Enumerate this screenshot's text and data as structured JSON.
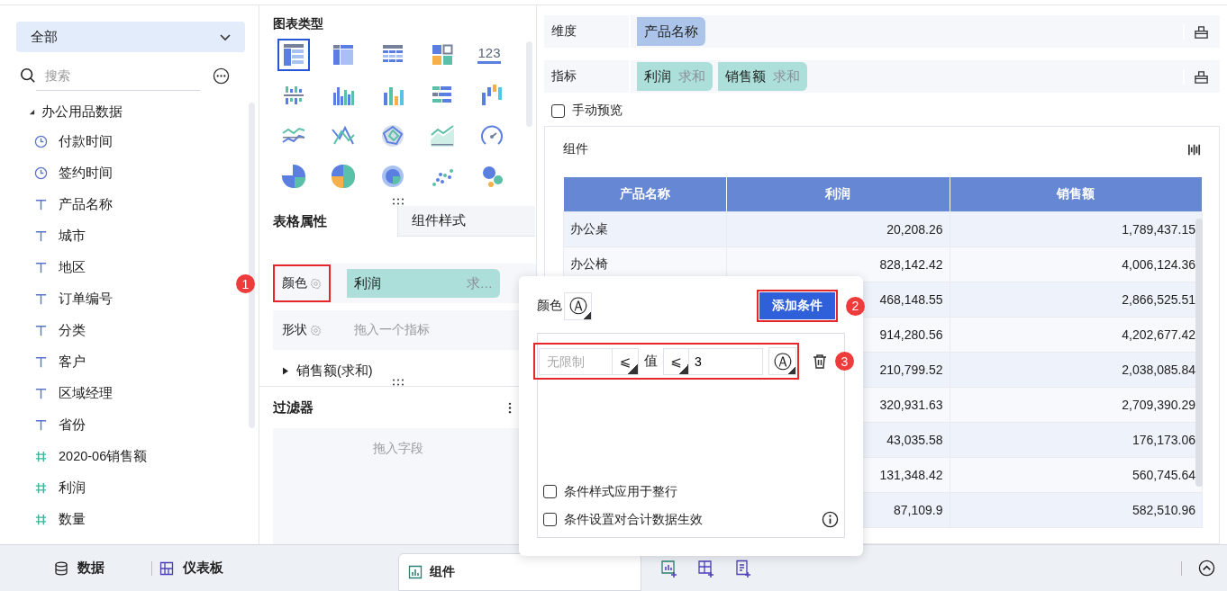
{
  "field_panel": {
    "scope": "全部",
    "search_placeholder": "搜索",
    "tree": [
      {
        "label": "办公用品数据",
        "expanded": true,
        "children": [
          {
            "label": "付款时间",
            "kind": "date"
          },
          {
            "label": "签约时间",
            "kind": "date"
          },
          {
            "label": "产品名称",
            "kind": "text"
          },
          {
            "label": "城市",
            "kind": "text"
          },
          {
            "label": "地区",
            "kind": "text"
          },
          {
            "label": "订单编号",
            "kind": "text"
          },
          {
            "label": "分类",
            "kind": "text"
          },
          {
            "label": "客户",
            "kind": "text"
          },
          {
            "label": "区域经理",
            "kind": "text"
          },
          {
            "label": "省份",
            "kind": "text"
          },
          {
            "label": "2020-06销售额",
            "kind": "number"
          },
          {
            "label": "利润",
            "kind": "number"
          },
          {
            "label": "数量",
            "kind": "number"
          }
        ]
      }
    ]
  },
  "chart_panel": {
    "title": "图表类型",
    "chart_types": [
      {
        "kind": "table",
        "selected": true
      },
      {
        "kind": "cross_table",
        "selected": false
      },
      {
        "kind": "detail_table",
        "selected": false
      },
      {
        "kind": "blocks",
        "selected": false
      },
      {
        "kind": "kpi",
        "label": "123",
        "selected": false
      },
      {
        "kind": "bar_split",
        "selected": false
      },
      {
        "kind": "bar_grouped",
        "selected": false
      },
      {
        "kind": "bar_colored",
        "selected": false
      },
      {
        "kind": "bar_horizontal",
        "selected": false
      },
      {
        "kind": "waterfall",
        "selected": false
      },
      {
        "kind": "line_multi",
        "selected": false
      },
      {
        "kind": "line_cross",
        "selected": false
      },
      {
        "kind": "radar",
        "selected": false
      },
      {
        "kind": "area",
        "selected": false
      },
      {
        "kind": "gauge",
        "selected": false
      },
      {
        "kind": "pie",
        "selected": false
      },
      {
        "kind": "pie_multi",
        "selected": false
      },
      {
        "kind": "ring",
        "selected": false
      },
      {
        "kind": "scatter",
        "selected": false
      },
      {
        "kind": "bubble",
        "selected": false
      }
    ]
  },
  "property_tabs": [
    {
      "label": "表格属性",
      "selected": true
    },
    {
      "label": "组件样式",
      "selected": false
    }
  ],
  "properties": [
    {
      "label": "颜色",
      "field": "利润",
      "aggregate": "求…",
      "callout": "1"
    },
    {
      "label": "形状",
      "placeholder": "拖入一个指标"
    }
  ],
  "series_item": {
    "label": "销售额(求和)",
    "expanded": false
  },
  "filter": {
    "title": "过滤器",
    "placeholder": "拖入字段"
  },
  "dimension": {
    "label": "维度",
    "fields": [
      {
        "name": "产品名称"
      }
    ]
  },
  "measures": {
    "label": "指标",
    "fields": [
      {
        "name": "利润",
        "aggregate": "求和"
      },
      {
        "name": "销售额",
        "aggregate": "求和"
      }
    ]
  },
  "manual_preview": {
    "label": "手动预览",
    "checked": false
  },
  "widget": {
    "title": "组件",
    "table": {
      "columns": [
        "产品名称",
        "利润",
        "销售额"
      ],
      "rows": [
        {
          "name": "办公桌",
          "profit": "20,208.26",
          "sales": "1,789,437.15"
        },
        {
          "name": "办公椅",
          "profit": "828,142.42",
          "sales": "4,006,124.36"
        },
        {
          "profit": "468,148.55",
          "sales": "2,866,525.51"
        },
        {
          "profit": "914,280.56",
          "sales": "4,202,677.42"
        },
        {
          "profit": "210,799.52",
          "sales": "2,038,085.84"
        },
        {
          "profit": "320,931.63",
          "sales": "2,709,390.29"
        },
        {
          "profit": "43,035.58",
          "sales": "176,173.06"
        },
        {
          "profit": "131,348.42",
          "sales": "560,745.64"
        },
        {
          "profit": "87,109.9",
          "sales": "582,510.96"
        }
      ]
    }
  },
  "popup": {
    "color_label": "颜色",
    "color_symbol": "Ⓐ",
    "add_button": "添加条件",
    "add_callout": "2",
    "condition": {
      "min_placeholder": "无限制",
      "op1": "⩽",
      "value_label": "值",
      "op2": "⩽",
      "value": "3",
      "color_symbol": "Ⓐ",
      "callout": "3"
    },
    "options": [
      {
        "label": "条件样式应用于整行",
        "checked": false
      },
      {
        "label": "条件设置对合计数据生效",
        "checked": false,
        "info": true
      }
    ]
  },
  "bottom_bar": {
    "tabs": [
      {
        "label": "数据"
      },
      {
        "label": "仪表板"
      }
    ],
    "widget_tab": {
      "label": "组件",
      "selected": true
    }
  }
}
